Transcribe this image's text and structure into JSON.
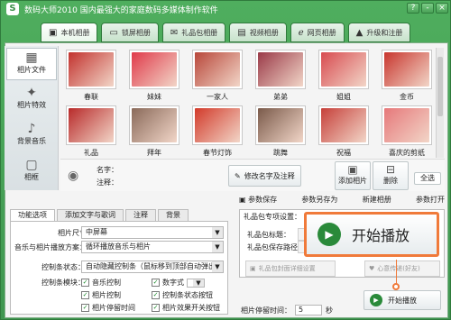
{
  "app": {
    "logo": "S",
    "title": "数码大师2010  国内最强大的家庭数码多媒体制作软件"
  },
  "window_controls": {
    "help": "?",
    "minimize": "-",
    "close": "×"
  },
  "tabs": [
    {
      "label": "本机相册",
      "icon": "album-icon"
    },
    {
      "label": "锁屏相册",
      "icon": "monitor-icon"
    },
    {
      "label": "礼品包相册",
      "icon": "gift-icon"
    },
    {
      "label": "视频相册",
      "icon": "film-icon"
    },
    {
      "label": "网页相册",
      "icon": "ie-icon"
    },
    {
      "label": "升级和注册",
      "icon": "upgrade-icon"
    }
  ],
  "sidebar": [
    {
      "label": "相片文件",
      "icon": "photo-files-icon"
    },
    {
      "label": "相片特效",
      "icon": "effects-icon"
    },
    {
      "label": "背景音乐",
      "icon": "music-icon"
    },
    {
      "label": "相框",
      "icon": "frame-icon"
    }
  ],
  "photos": [
    {
      "caption": "春联",
      "color": "#c2322e"
    },
    {
      "caption": "妹妹",
      "color": "#e03a4a"
    },
    {
      "caption": "一家人",
      "color": "#b8473a"
    },
    {
      "caption": "弟弟",
      "color": "#9a3a48"
    },
    {
      "caption": "姐姐",
      "color": "#d84b50"
    },
    {
      "caption": "金币",
      "color": "#c8362e"
    },
    {
      "caption": "礼品",
      "color": "#b82a2a"
    },
    {
      "caption": "拜年",
      "color": "#8a6a5a"
    },
    {
      "caption": "春节灯饰",
      "color": "#d23a2a"
    },
    {
      "caption": "跳舞",
      "color": "#7a5a4a"
    },
    {
      "caption": "祝福",
      "color": "#c6403a"
    },
    {
      "caption": "喜庆的剪纸",
      "color": "#e6787a"
    }
  ],
  "namerow": {
    "name_label": "名字：",
    "note_label": "注释：",
    "edit_button": "修改名字及注释",
    "add_button": "添加相片",
    "delete_button": "删除",
    "select_all": "全选"
  },
  "savebar": {
    "save": "参数保存",
    "save_as": "参数另存为",
    "new": "新建相册",
    "open": "参数打开"
  },
  "bottom_tabs": [
    "功能选项",
    "添加文字与歌词",
    "注释",
    "背景"
  ],
  "options": {
    "size_label": "相片尺寸：",
    "size_value": "中屏幕",
    "music_label": "音乐与相片播放方案：",
    "music_value": "循环播放音乐与相片",
    "bar_label": "控制条状态：",
    "bar_value": "自动隐藏控制条（鼠标移到顶部自动弹出）",
    "module_label": "控制条模块：",
    "checks": [
      "音乐控制",
      "数字式",
      "相片控制",
      "控制条状态按钮",
      "相片停留时间",
      "相片效果开关按钮"
    ]
  },
  "gift": {
    "header": "礼品包专项设置：",
    "title_label": "礼品包标题：",
    "path_label": "礼品包保存路径：",
    "detail_button": "礼品包封面详细设置",
    "send_button": "心意传递(好友)"
  },
  "play": {
    "big": "开始播放",
    "small": "开始播放"
  },
  "stay": {
    "label": "相片停留时间：",
    "value": "5",
    "unit": "秒"
  }
}
